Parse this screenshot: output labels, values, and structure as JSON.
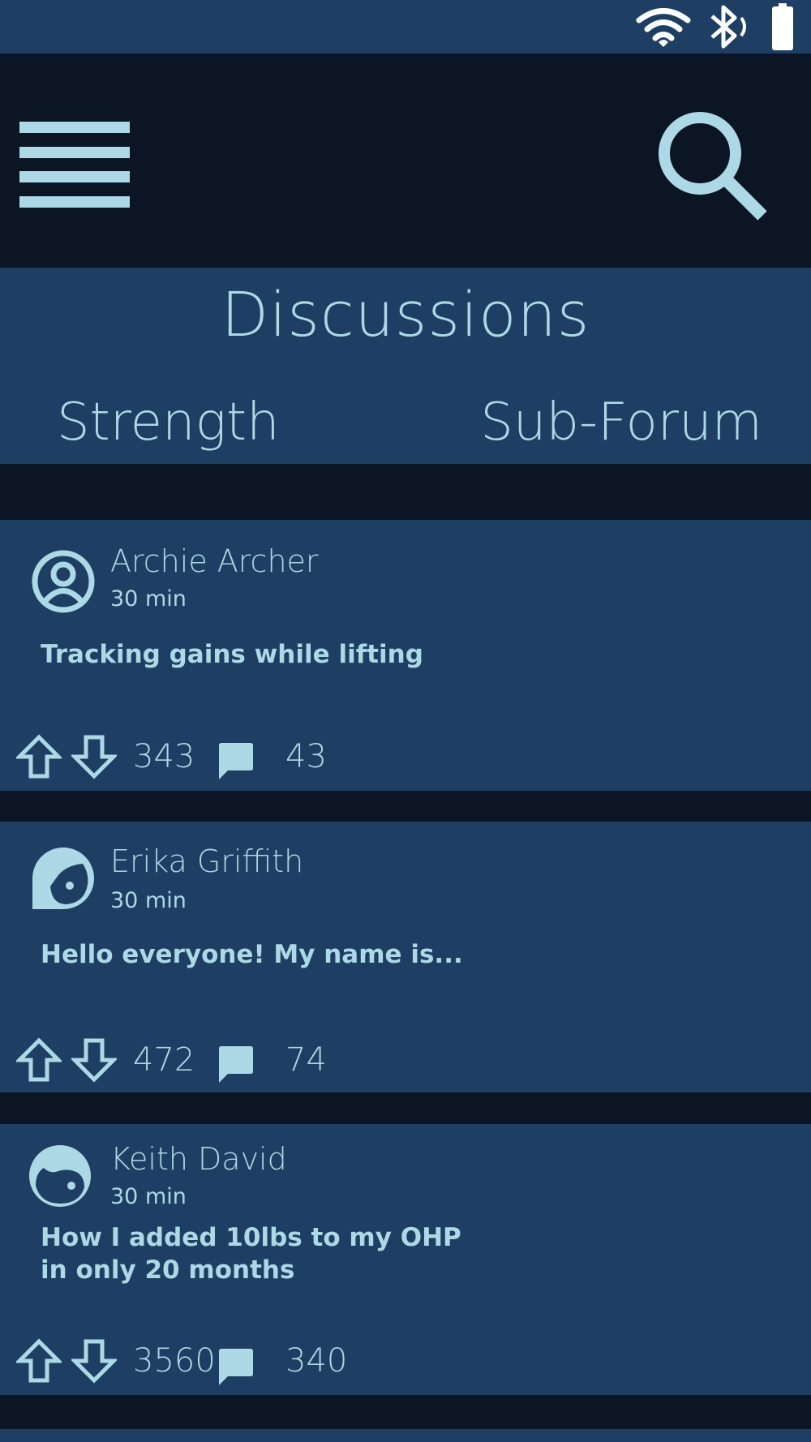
{
  "status_bar": {
    "icons": [
      "wifi-icon",
      "bluetooth-icon",
      "battery-icon"
    ]
  },
  "app_bar": {
    "icons": [
      "menu-icon",
      "search-icon"
    ]
  },
  "header": {
    "title": "Discussions",
    "forum_name": "Strength",
    "forum_type": "Sub-Forum"
  },
  "posts": [
    {
      "author": "Archie Archer",
      "time": "30 min",
      "title": "Tracking gains while lifting",
      "votes": "343",
      "comments": "43",
      "avatar_icon": "person-circle-icon"
    },
    {
      "author": "Erika Griffith",
      "time": "30 min",
      "title": "Hello everyone! My name is...",
      "votes": "472",
      "comments": "74",
      "avatar_icon": "face-woman-icon"
    },
    {
      "author": "Keith David",
      "time": "30 min",
      "title": "How I added 10lbs to my OHP in only 20 months",
      "votes": "3560",
      "comments": "340",
      "avatar_icon": "face-man-icon"
    }
  ],
  "colors": {
    "background": "#0c1523",
    "panel": "#1e3f63",
    "accent": "#add8e6",
    "status_icons": "#ffffff"
  }
}
